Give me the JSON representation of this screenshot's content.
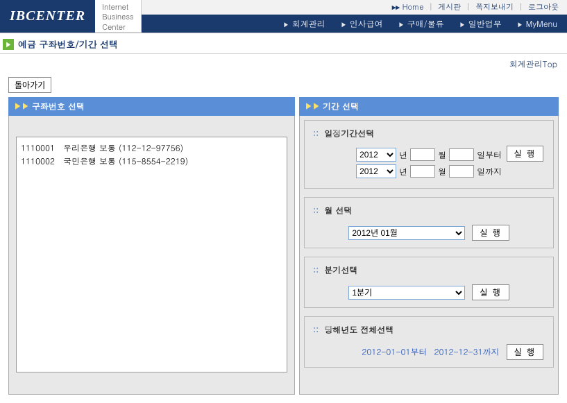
{
  "header": {
    "logo": "IBCENTER",
    "tagline_l1": "Internet",
    "tagline_l2": "Business",
    "tagline_l3": "Center",
    "top_links": {
      "arrow": "▸▸",
      "home": "Home",
      "board": "게시판",
      "note": "쪽지보내기",
      "logout": "로그아웃"
    },
    "nav": {
      "acct": "회계관리",
      "hr": "인사급여",
      "purchase": "구매/물류",
      "general": "일반업무",
      "mymenu": "MyMenu"
    }
  },
  "page": {
    "title": "예금 구좌번호/기간 선택",
    "top_link": "회계관리Top",
    "back_btn": "돌아가기"
  },
  "panels": {
    "left_title": "구좌번호 선택",
    "right_title": "기간 선택"
  },
  "accounts": [
    "1110001   우리은행 보통 (112-12-97756)",
    "1110002   국민은행 보통 (115-8554-2219)"
  ],
  "period": {
    "sec1_title": "일정기간선택",
    "year1": "2012",
    "year2": "2012",
    "lbl_year": "년",
    "lbl_month": "월",
    "lbl_day_from": "일부터",
    "lbl_day_to": "일까지",
    "sec2_title": "월 선택",
    "month_select": "2012년 01월",
    "sec3_title": "분기선택",
    "quarter_select": "1분기",
    "sec4_title": "당해년도 전체선택",
    "range_from": "2012-01-01부터",
    "range_to": "2012-12-31까지",
    "exec_btn": "실 행"
  }
}
